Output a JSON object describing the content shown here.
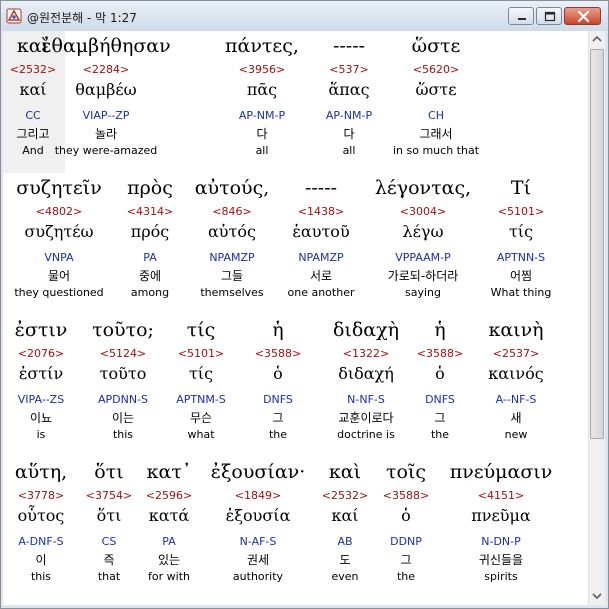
{
  "window": {
    "title": "@원전분해 - 막 1:27",
    "icon": "app-logo-icon",
    "controls": [
      "minimize-icon",
      "maximize-icon",
      "close-icon"
    ]
  },
  "verses": [
    {
      "highlight_word": 0,
      "words": [
        {
          "greek": "καὶ",
          "strong": "<2532>",
          "lemma": "καί",
          "parsing": "CC",
          "korean": "그리고",
          "english": "And"
        },
        {
          "greek": "ἐθαμβήθησαν",
          "strong": "<2284>",
          "lemma": "θαμβέω",
          "parsing": "VIAP--ZP",
          "korean": "놀라",
          "english": "they were-amazed"
        },
        {
          "greek": "πάντες,",
          "strong": "<3956>",
          "lemma": "πᾶς",
          "parsing": "AP-NM-P",
          "korean": "다",
          "english": "all"
        },
        {
          "greek": "-----",
          "strong": "<537>",
          "lemma": "ἅπας",
          "parsing": "AP-NM-P",
          "korean": "다",
          "english": "all"
        },
        {
          "greek": "ὥστε",
          "strong": "<5620>",
          "lemma": "ὥστε",
          "parsing": "CH",
          "korean": "그래서",
          "english": "in so much that"
        }
      ]
    },
    {
      "words": [
        {
          "greek": "συζητεῖν",
          "strong": "<4802>",
          "lemma": "συζητέω",
          "parsing": "VNPA",
          "korean": "물어",
          "english": "they questioned"
        },
        {
          "greek": "πρὸς",
          "strong": "<4314>",
          "lemma": "πρός",
          "parsing": "PA",
          "korean": "중에",
          "english": "among"
        },
        {
          "greek": "αὐτούς,",
          "strong": "<846>",
          "lemma": "αὐτός",
          "parsing": "NPAMZP",
          "korean": "그들",
          "english": "themselves"
        },
        {
          "greek": "-----",
          "strong": "<1438>",
          "lemma": "ἑαυτοῦ",
          "parsing": "NPAMZP",
          "korean": "서로",
          "english": "one another"
        },
        {
          "greek": "λέγοντας,",
          "strong": "<3004>",
          "lemma": "λέγω",
          "parsing": "VPPAAM-P",
          "korean": "가로되-하더라",
          "english": "saying"
        },
        {
          "greek": "Τί",
          "strong": "<5101>",
          "lemma": "τίς",
          "parsing": "APTNN-S",
          "korean": "어찜",
          "english": "What thing"
        }
      ]
    },
    {
      "words": [
        {
          "greek": "ἐστιν",
          "strong": "<2076>",
          "lemma": "ἐστίν",
          "parsing": "VIPA--ZS",
          "korean": "이뇨",
          "english": "is"
        },
        {
          "greek": "τοῦτο;",
          "strong": "<5124>",
          "lemma": "τοῦτο",
          "parsing": "APDNN-S",
          "korean": "이는",
          "english": "this"
        },
        {
          "greek": "τίς",
          "strong": "<5101>",
          "lemma": "τίς",
          "parsing": "APTNM-S",
          "korean": "무슨",
          "english": "what"
        },
        {
          "greek": "ἡ",
          "strong": "<3588>",
          "lemma": "ὁ",
          "parsing": "DNFS",
          "korean": "그",
          "english": "the"
        },
        {
          "greek": "διδαχὴ",
          "strong": "<1322>",
          "lemma": "διδαχή",
          "parsing": "N-NF-S",
          "korean": "교훈이로다",
          "english": "doctrine is"
        },
        {
          "greek": "ἡ",
          "strong": "<3588>",
          "lemma": "ὁ",
          "parsing": "DNFS",
          "korean": "그",
          "english": "the"
        },
        {
          "greek": "καινὴ",
          "strong": "<2537>",
          "lemma": "καινός",
          "parsing": "A--NF-S",
          "korean": "새",
          "english": "new"
        }
      ]
    },
    {
      "words": [
        {
          "greek": "αὕτη,",
          "strong": "<3778>",
          "lemma": "οὗτος",
          "parsing": "A-DNF-S",
          "korean": "이",
          "english": "this"
        },
        {
          "greek": "ὅτι",
          "strong": "<3754>",
          "lemma": "ὅτι",
          "parsing": "CS",
          "korean": "즉",
          "english": "that"
        },
        {
          "greek": "κατ᾽",
          "strong": "<2596>",
          "lemma": "κατά",
          "parsing": "PA",
          "korean": "있는",
          "english": "for with"
        },
        {
          "greek": "ἐξουσίαν·",
          "strong": "<1849>",
          "lemma": "ἐξουσία",
          "parsing": "N-AF-S",
          "korean": "권세",
          "english": "authority"
        },
        {
          "greek": "καὶ",
          "strong": "<2532>",
          "lemma": "καί",
          "parsing": "AB",
          "korean": "도",
          "english": "even"
        },
        {
          "greek": "τοῖς",
          "strong": "<3588>",
          "lemma": "ὁ",
          "parsing": "DDNP",
          "korean": "그",
          "english": "the"
        },
        {
          "greek": "πνεύμασιν",
          "strong": "<4151>",
          "lemma": "πνεῦμα",
          "parsing": "N-DN-P",
          "korean": "귀신들을",
          "english": "spirits"
        }
      ]
    }
  ]
}
